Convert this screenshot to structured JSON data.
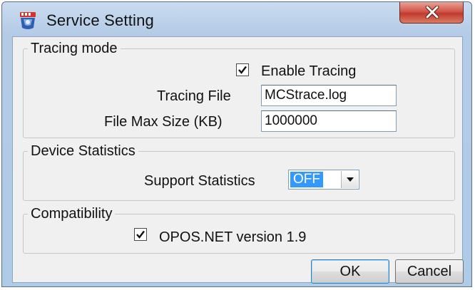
{
  "window": {
    "title": "Service Setting",
    "icon": "service-app-icon",
    "close_icon": "close-x-icon"
  },
  "tracing_mode": {
    "legend": "Tracing mode",
    "enable_tracing": {
      "label": "Enable Tracing",
      "checked": true
    },
    "tracing_file": {
      "label": "Tracing File",
      "value": "MCStrace.log"
    },
    "file_max_size": {
      "label": "File Max Size (KB)",
      "value": "1000000"
    }
  },
  "device_statistics": {
    "legend": "Device Statistics",
    "support_statistics": {
      "label": "Support Statistics",
      "value": "OFF"
    }
  },
  "compatibility": {
    "legend": "Compatibility",
    "opos_net": {
      "label": "OPOS.NET version 1.9",
      "checked": true
    }
  },
  "buttons": {
    "ok": "OK",
    "cancel": "Cancel"
  },
  "colors": {
    "selection": "#3399ff",
    "close_button": "#c0392f",
    "frame": "#b4cbe6"
  }
}
